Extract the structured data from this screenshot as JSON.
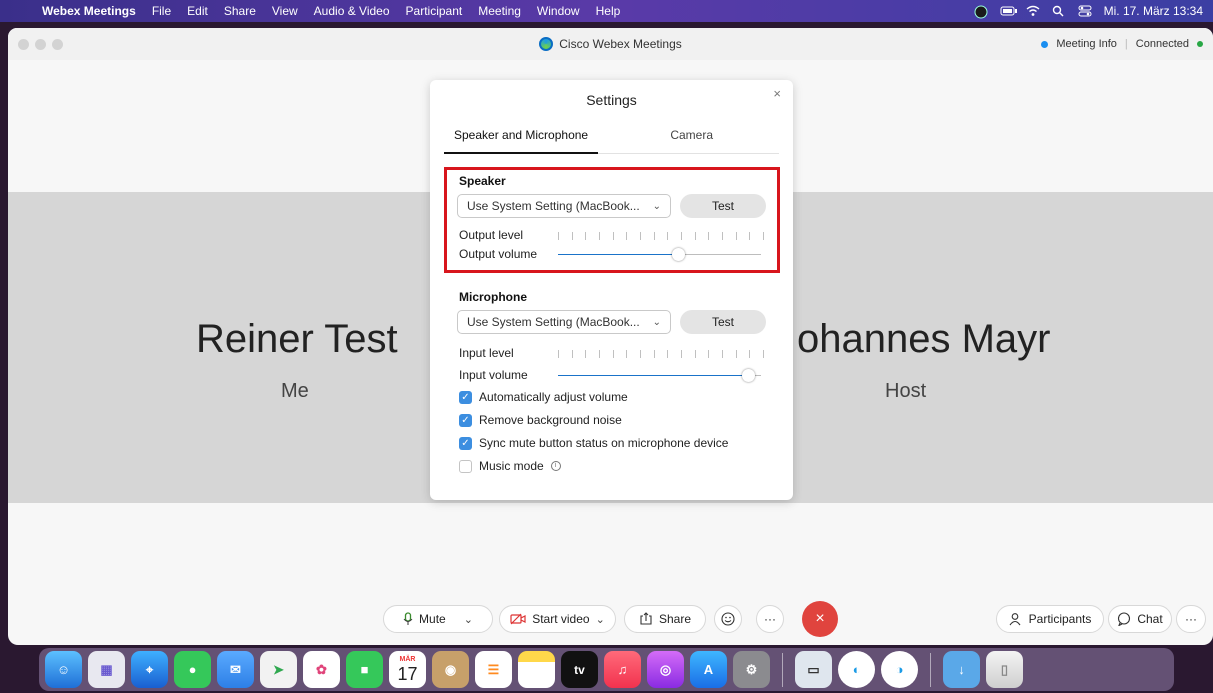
{
  "menubar": {
    "app_name": "Webex Meetings",
    "menus": [
      "File",
      "Edit",
      "Share",
      "View",
      "Audio & Video",
      "Participant",
      "Meeting",
      "Window",
      "Help"
    ],
    "clock": "Mi. 17. März  13:34"
  },
  "window": {
    "title": "Cisco Webex Meetings",
    "meeting_info": "Meeting Info",
    "status": "Connected"
  },
  "participants": [
    {
      "name": "Reiner Test",
      "role": "Me"
    },
    {
      "name": "ohannes Mayr",
      "role": "Host"
    }
  ],
  "settings": {
    "title": "Settings",
    "close": "×",
    "tabs": [
      "Speaker and Microphone",
      "Camera"
    ],
    "speaker": {
      "heading": "Speaker",
      "device": "Use System Setting (MacBook...",
      "test_label": "Test",
      "output_level_label": "Output level",
      "output_volume_label": "Output volume",
      "output_volume": 0.6
    },
    "microphone": {
      "heading": "Microphone",
      "device": "Use System Setting (MacBook...",
      "test_label": "Test",
      "input_level_label": "Input level",
      "input_volume_label": "Input volume",
      "input_volume": 0.97
    },
    "options": [
      {
        "label": "Automatically adjust volume",
        "checked": true
      },
      {
        "label": "Remove background noise",
        "checked": true
      },
      {
        "label": "Sync mute button status on microphone device",
        "checked": true
      },
      {
        "label": "Music mode",
        "checked": false
      }
    ]
  },
  "controls": {
    "mute": "Mute",
    "start_video": "Start video",
    "share": "Share",
    "more": "···",
    "end": "×",
    "participants": "Participants",
    "chat": "Chat"
  },
  "dock": {
    "calendar_month": "MÄR",
    "calendar_day": "17",
    "tv_label": "tv"
  },
  "colors": {
    "accent": "#1a73c9",
    "highlight": "#d8161d",
    "end_call": "#e0443e"
  }
}
